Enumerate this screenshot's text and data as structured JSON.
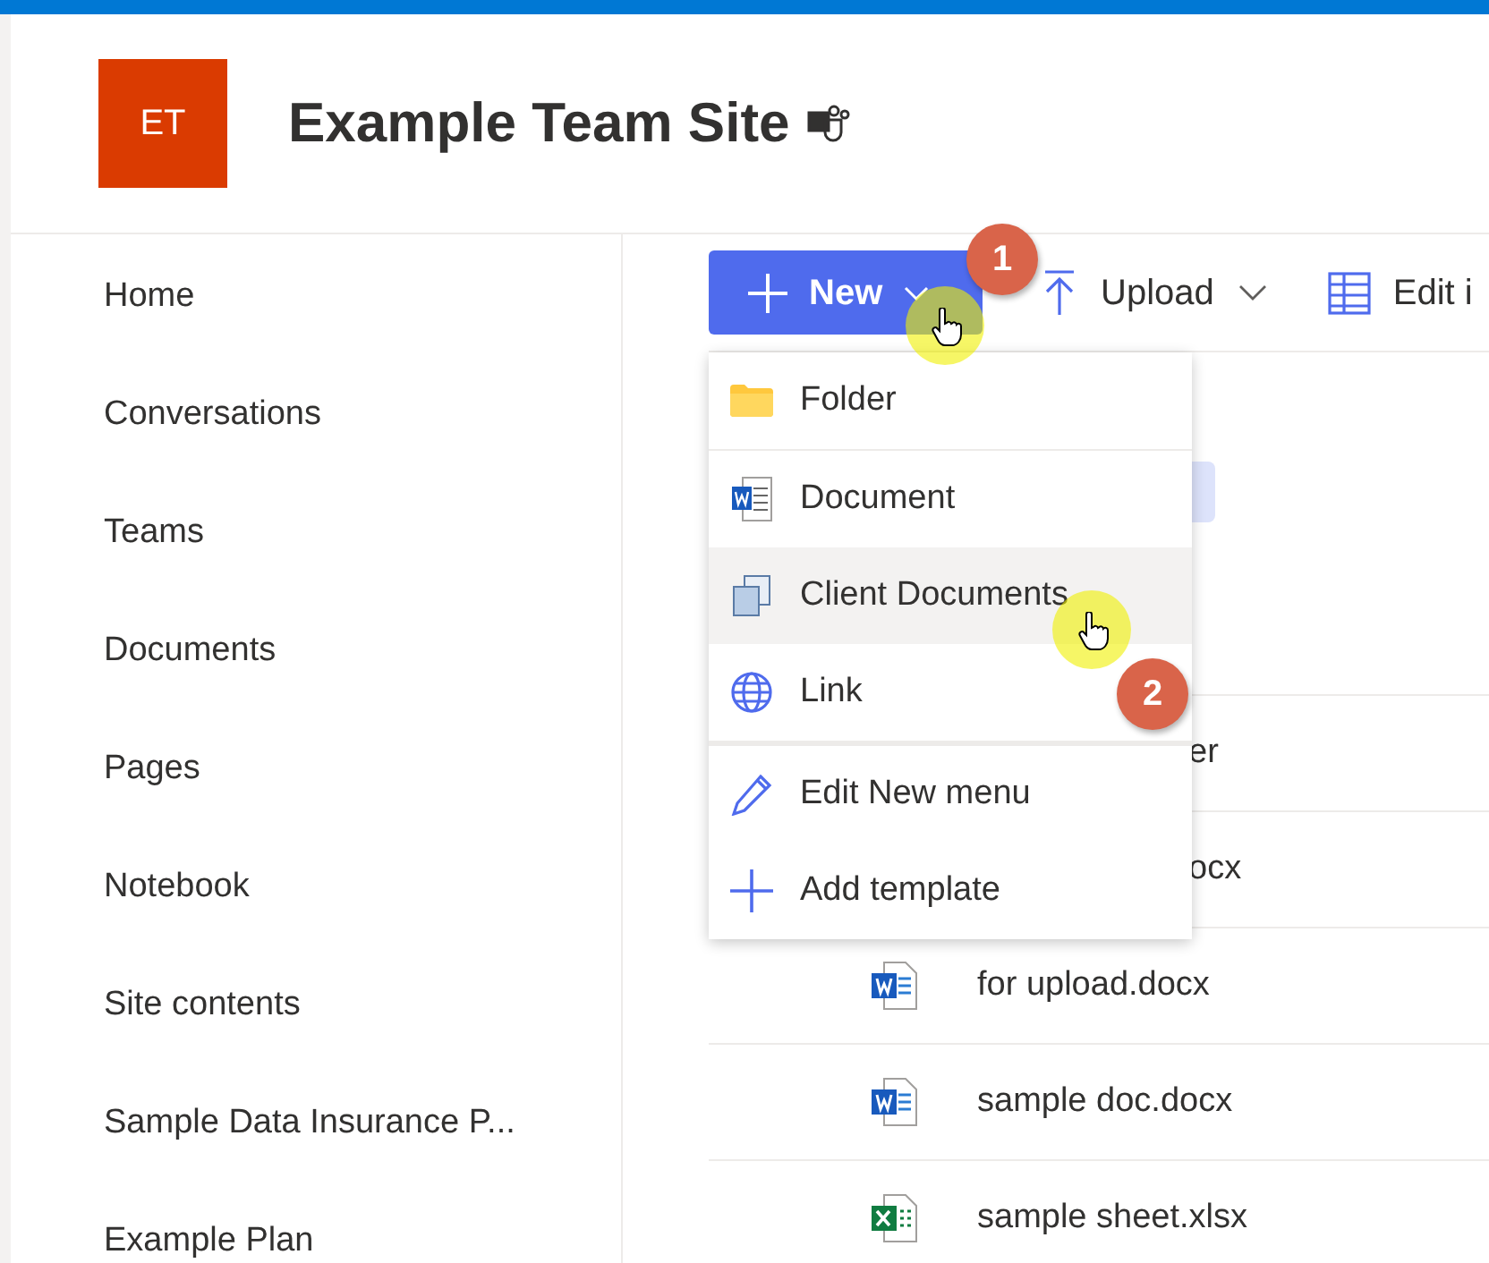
{
  "site": {
    "logo": "ET",
    "title": "Example Team Site"
  },
  "nav": {
    "items": [
      {
        "label": "Home"
      },
      {
        "label": "Conversations"
      },
      {
        "label": "Teams"
      },
      {
        "label": "Documents"
      },
      {
        "label": "Pages"
      },
      {
        "label": "Notebook"
      },
      {
        "label": "Site contents"
      },
      {
        "label": "Sample Data Insurance P..."
      },
      {
        "label": "Example Plan"
      }
    ]
  },
  "command_bar": {
    "new_button": "New",
    "upload_button": "Upload",
    "edit_button": "Edit i"
  },
  "new_menu": {
    "items": [
      {
        "label": "Folder",
        "selected": false
      },
      {
        "label": "Document",
        "selected": false
      },
      {
        "label": "Client Documents",
        "selected": true
      },
      {
        "label": "Link",
        "selected": false
      },
      {
        "label": "Edit New menu",
        "selected": false
      },
      {
        "label": "Add template",
        "selected": false
      }
    ]
  },
  "files": {
    "rows": [
      {
        "name": "er",
        "kind": "hidden"
      },
      {
        "name": "ocx",
        "kind": "hidden"
      },
      {
        "name": "for upload.docx",
        "kind": "docx"
      },
      {
        "name": "sample doc.docx",
        "kind": "docx"
      },
      {
        "name": "sample sheet.xlsx",
        "kind": "xlsx"
      }
    ]
  },
  "annotations": [
    {
      "label": "1"
    },
    {
      "label": "2"
    }
  ]
}
